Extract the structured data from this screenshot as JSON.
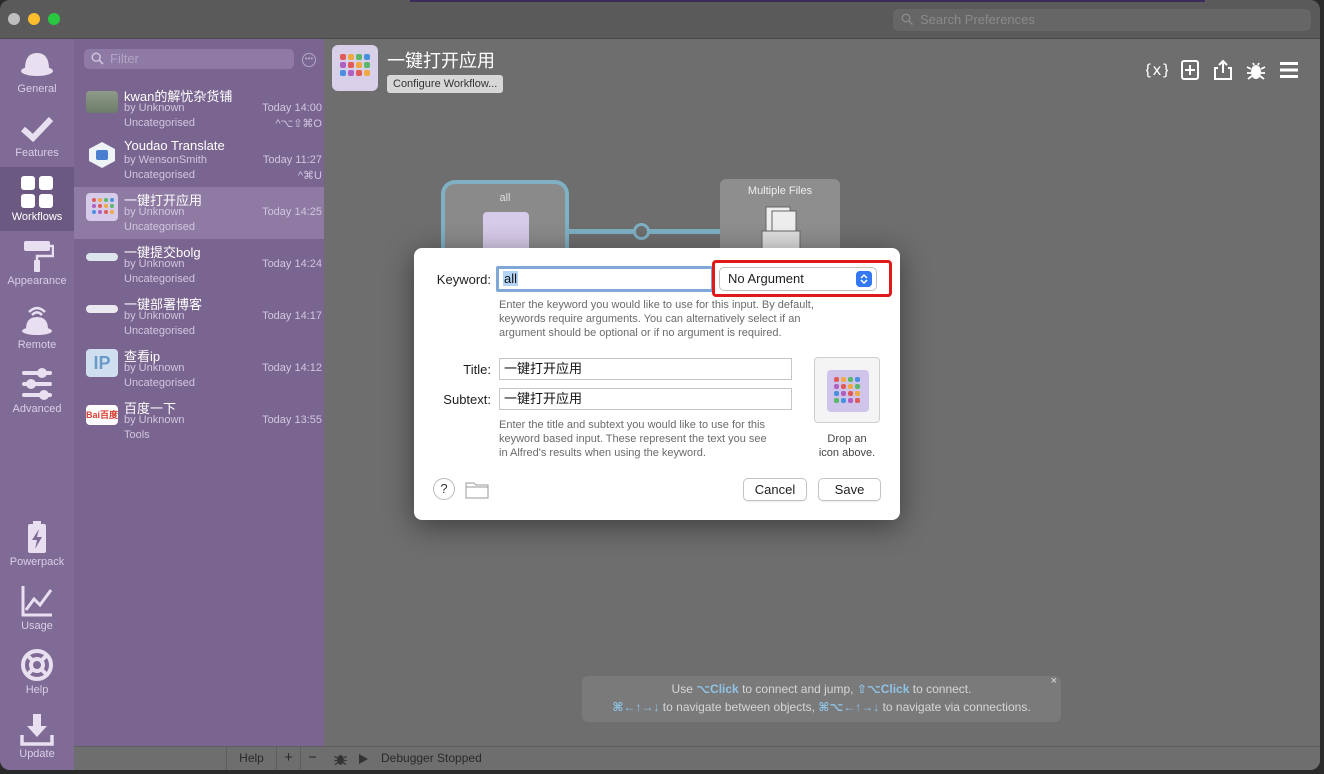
{
  "window": {
    "search_placeholder": "Search Preferences"
  },
  "sidebar": {
    "items": [
      {
        "label": "General",
        "icon": "hat-icon"
      },
      {
        "label": "Features",
        "icon": "checkmark-icon"
      },
      {
        "label": "Workflows",
        "icon": "grid-icon",
        "active": true
      },
      {
        "label": "Appearance",
        "icon": "paint-roller-icon"
      },
      {
        "label": "Remote",
        "icon": "remote-icon"
      },
      {
        "label": "Advanced",
        "icon": "sliders-icon"
      },
      {
        "label": "Powerpack",
        "icon": "battery-icon"
      },
      {
        "label": "Usage",
        "icon": "chart-icon"
      },
      {
        "label": "Help",
        "icon": "lifebuoy-icon"
      },
      {
        "label": "Update",
        "icon": "download-icon"
      }
    ]
  },
  "workflow_list": {
    "filter_placeholder": "Filter",
    "items": [
      {
        "name": "kwan的解忧杂货铺",
        "by": "by Unknown",
        "category": "Uncategorised",
        "time": "Today 14:00",
        "hotkey": "^⌥⇧⌘O"
      },
      {
        "name": "Youdao Translate",
        "by": "by WensonSmith",
        "category": "Uncategorised",
        "time": "Today 11:27",
        "hotkey": "^⌘U"
      },
      {
        "name": "一键打开应用",
        "by": "by Unknown",
        "category": "Uncategorised",
        "time": "Today 14:25",
        "hotkey": ""
      },
      {
        "name": "一键提交bolg",
        "by": "by Unknown",
        "category": "Uncategorised",
        "time": "Today 14:24",
        "hotkey": ""
      },
      {
        "name": "一键部署博客",
        "by": "by Unknown",
        "category": "Uncategorised",
        "time": "Today 14:17",
        "hotkey": ""
      },
      {
        "name": "查看ip",
        "by": "by Unknown",
        "category": "Uncategorised",
        "time": "Today 14:12",
        "hotkey": ""
      },
      {
        "name": "百度一下",
        "by": "by Unknown",
        "category": "Tools",
        "time": "Today 13:55",
        "hotkey": ""
      }
    ],
    "footer": {
      "help": "Help",
      "add": "+",
      "remove": "−"
    }
  },
  "workflow": {
    "title": "一键打开应用",
    "configure_label": "Configure Workflow...",
    "nodes": {
      "keyword_label": "all",
      "action_label": "Multiple Files"
    }
  },
  "dialog": {
    "keyword_label": "Keyword:",
    "keyword_value": "all",
    "argument_option": "No Argument",
    "keyword_help": [
      "Enter the keyword you would like to use for this input. By default,",
      "keywords require arguments. You can alternatively select if an",
      "argument should be optional or if no argument is required."
    ],
    "title_label": "Title:",
    "title_value": "一键打开应用",
    "subtext_label": "Subtext:",
    "subtext_value": "一键打开应用",
    "title_help": [
      "Enter the title and subtext you would like to use for this",
      "keyword based input. These represent the text you see",
      "in Alfred's results when using the keyword."
    ],
    "drop_icon_text": [
      "Drop an",
      "icon above."
    ],
    "help_button": "?",
    "cancel_label": "Cancel",
    "save_label": "Save"
  },
  "hint": {
    "use": "Use",
    "click1": "⌥Click",
    "mid1": "to connect and jump,",
    "click2": "⇧⌥Click",
    "end1": "to connect.",
    "keys1": "⌘←↑→↓",
    "mid2": "to navigate between objects,",
    "keys2": "⌘⌥←↑→↓",
    "end2": "to navigate via connections.",
    "close": "×"
  },
  "debugger": {
    "status": "Debugger Stopped"
  },
  "colors": {
    "accent": "#3478f6",
    "sidebar": "#7f6b95",
    "highlight_box": "#e01a1a"
  }
}
